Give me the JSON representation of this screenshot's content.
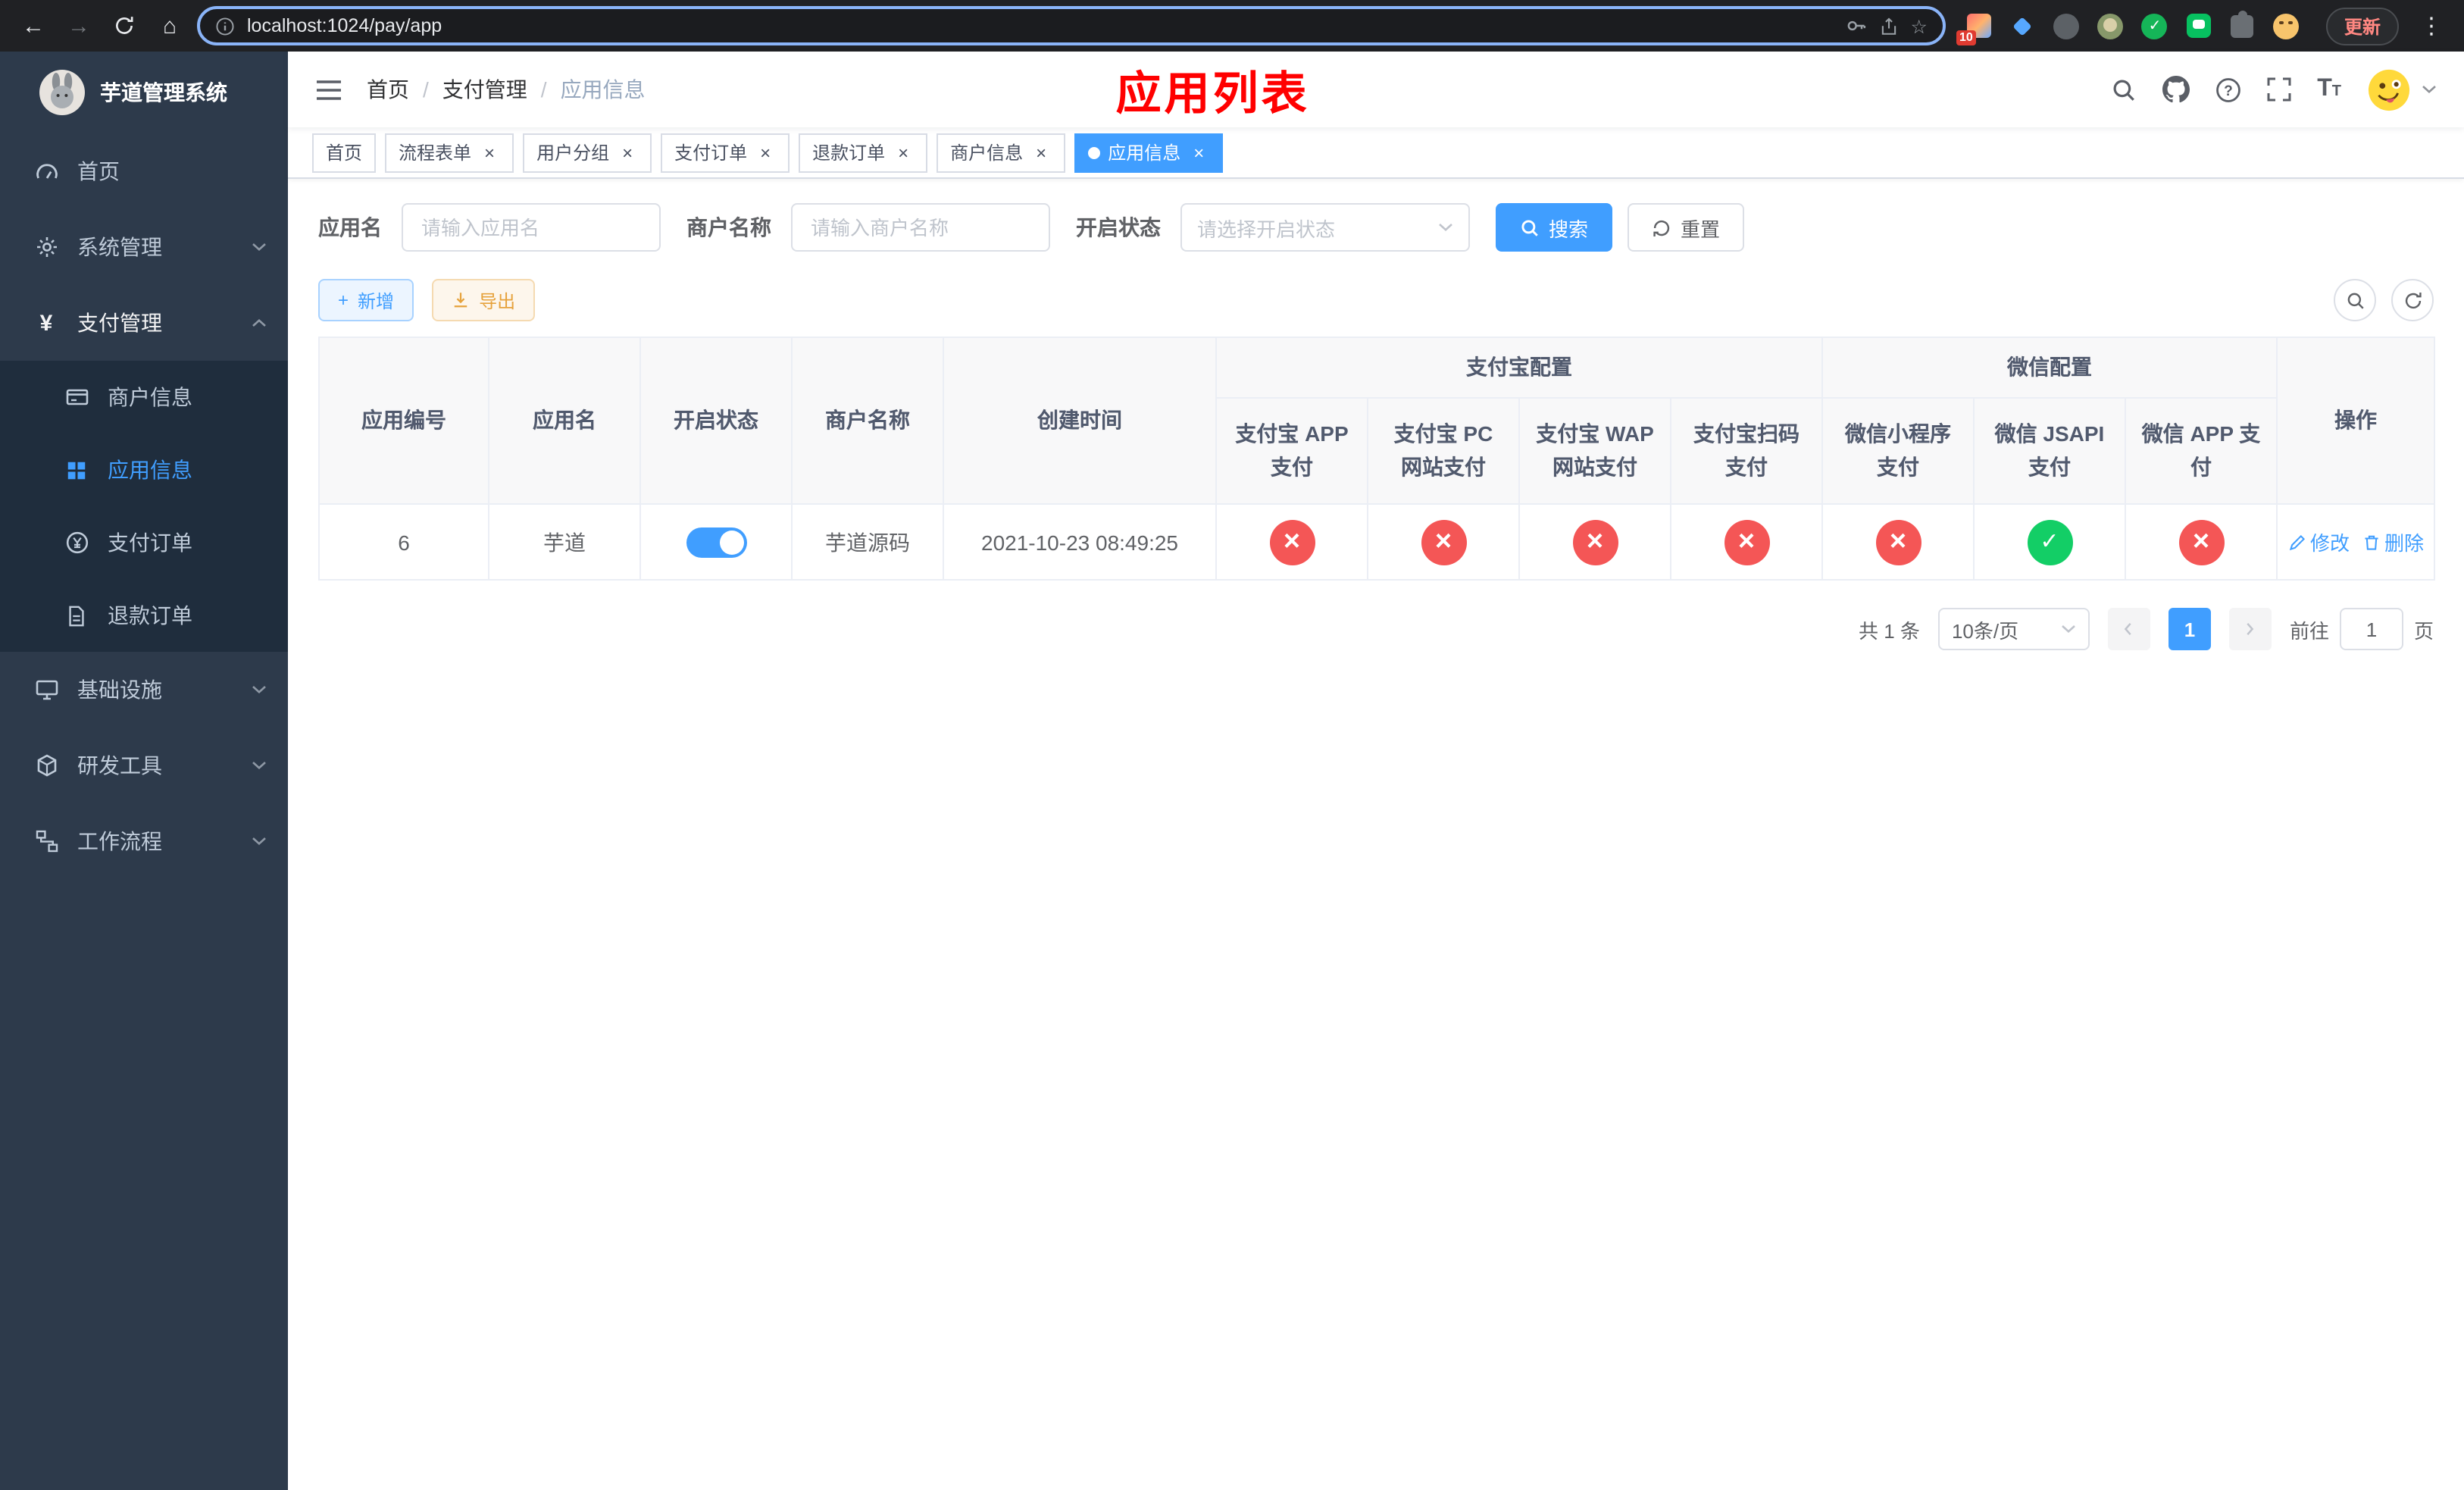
{
  "colors": {
    "accent": "#409eff",
    "page_title_red": "#ff0000",
    "danger_red": "#f45656",
    "success_green": "#13ce66",
    "warning_orange": "#e6a23c",
    "sidebar_bg": "#2d3a4b",
    "submenu_bg": "#1f2d3d"
  },
  "browser": {
    "url": "localhost:1024/pay/app",
    "extension_badge": "10",
    "update_label": "更新"
  },
  "sidebar": {
    "logo_title": "芋道管理系统",
    "home": "首页",
    "system": "系统管理",
    "payment": "支付管理",
    "merchant_info": "商户信息",
    "app_info": "应用信息",
    "pay_order": "支付订单",
    "refund_order": "退款订单",
    "infra": "基础设施",
    "dev_tools": "研发工具",
    "workflow": "工作流程"
  },
  "navbar": {
    "breadcrumb": [
      "首页",
      "支付管理",
      "应用信息"
    ],
    "separator": "/",
    "page_title": "应用列表"
  },
  "tabs": [
    {
      "label": "首页",
      "closable": false,
      "active": false
    },
    {
      "label": "流程表单",
      "closable": true,
      "active": false
    },
    {
      "label": "用户分组",
      "closable": true,
      "active": false
    },
    {
      "label": "支付订单",
      "closable": true,
      "active": false
    },
    {
      "label": "退款订单",
      "closable": true,
      "active": false
    },
    {
      "label": "商户信息",
      "closable": true,
      "active": false
    },
    {
      "label": "应用信息",
      "closable": true,
      "active": true
    }
  ],
  "filters": {
    "app_name_label": "应用名",
    "app_name_placeholder": "请输入应用名",
    "merchant_label": "商户名称",
    "merchant_placeholder": "请输入商户名称",
    "status_label": "开启状态",
    "status_placeholder": "请选择开启状态",
    "search_button": "搜索",
    "reset_button": "重置"
  },
  "toolbar": {
    "add_button": "新增",
    "export_button": "导出"
  },
  "table": {
    "col_id": "应用编号",
    "col_name": "应用名",
    "col_status": "开启状态",
    "col_merchant": "商户名称",
    "col_created": "创建时间",
    "group_alipay": "支付宝配置",
    "group_wechat": "微信配置",
    "col_alipay_app": "支付宝 APP 支付",
    "col_alipay_pc": "支付宝 PC 网站支付",
    "col_alipay_wap": "支付宝 WAP 网站支付",
    "col_alipay_qr": "支付宝扫码支付",
    "col_wx_mini": "微信小程序支付",
    "col_wx_jsapi": "微信 JSAPI 支付",
    "col_wx_app": "微信 APP 支付",
    "col_actions": "操作",
    "rows": [
      {
        "id": "6",
        "name": "芋道",
        "enabled": true,
        "merchant": "芋道源码",
        "created": "2021-10-23 08:49:25",
        "alipay_app": false,
        "alipay_pc": false,
        "alipay_wap": false,
        "alipay_qr": false,
        "wx_mini": false,
        "wx_jsapi": true,
        "wx_app": false,
        "edit_label": "修改",
        "delete_label": "删除"
      }
    ]
  },
  "pagination": {
    "total": "共 1 条",
    "page_size": "10条/页",
    "current_page": "1",
    "goto_label": "前往",
    "goto_value": "1",
    "page_suffix": "页"
  }
}
